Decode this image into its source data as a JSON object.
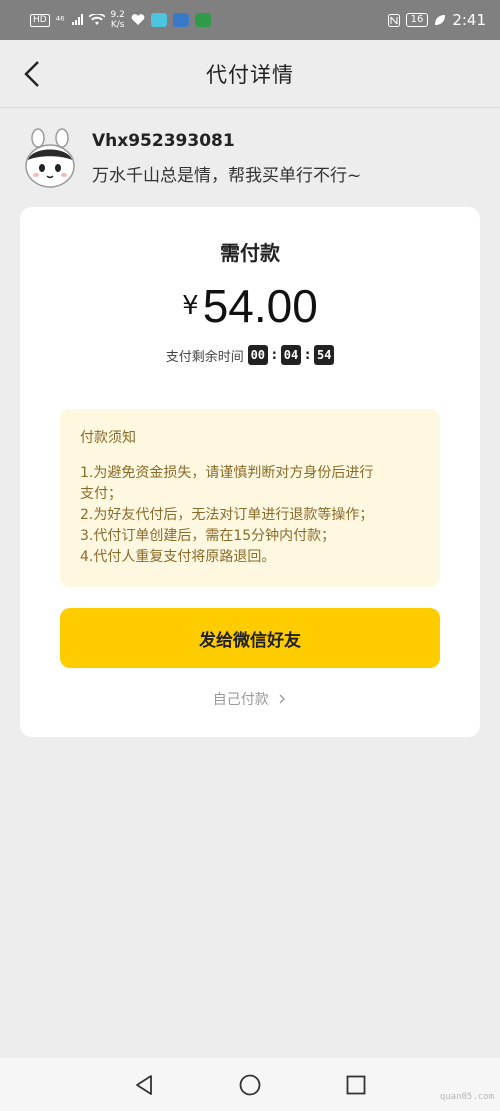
{
  "status_bar": {
    "hd": "HD",
    "signal": "⁴⁶",
    "speed": "9.2",
    "speed_unit": "K/s",
    "battery": "16",
    "time": "2:41"
  },
  "nav": {
    "title": "代付详情"
  },
  "user": {
    "name": "Vhx952393081",
    "message": "万水千山总是情，帮我买单行不行~"
  },
  "payment": {
    "label": "需付款",
    "currency": "¥",
    "amount": "54.00",
    "countdown_label": "支付剩余时间",
    "countdown": {
      "h": "00",
      "m": "04",
      "s": "54"
    }
  },
  "notice": {
    "title": "付款须知",
    "lines": [
      "1.为避免资金损失，请谨慎判断对方身份后进行",
      "支付；",
      "2.为好友代付后，无法对订单进行退款等操作；",
      "3.代付订单创建后，需在15分钟内付款；",
      "4.代付人重复支付将原路退回。"
    ]
  },
  "actions": {
    "send_wechat": "发给微信好友",
    "self_pay": "自己付款"
  },
  "watermark": "quan05.com",
  "colors": {
    "accent": "#ffcc00",
    "notice_bg": "#fff8e0",
    "notice_text": "#8a6a2a"
  }
}
